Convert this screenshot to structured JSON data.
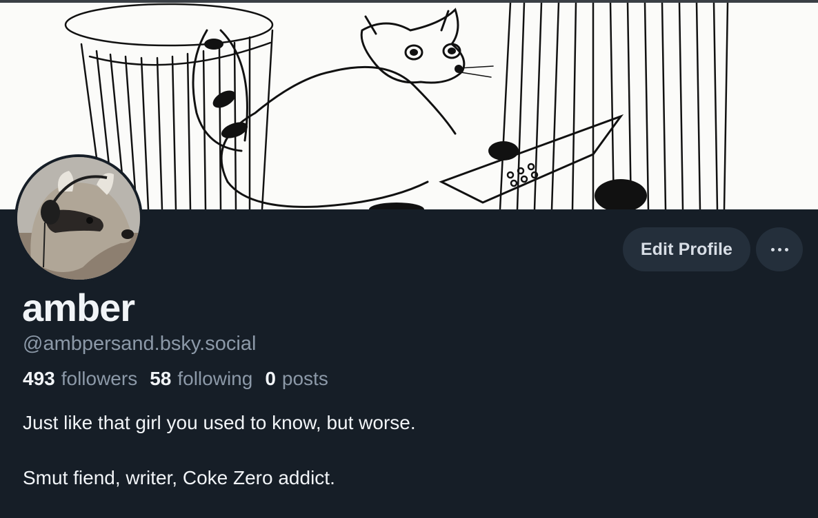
{
  "banner": {
    "icon": "raccoon-trashcan-sketch"
  },
  "avatar": {
    "icon": "raccoon-headphones-photo"
  },
  "actions": {
    "edit_profile_label": "Edit Profile",
    "more_icon": "ellipsis-icon"
  },
  "profile": {
    "display_name": "amber",
    "handle": "@ambpersand.bsky.social",
    "stats": {
      "followers_count": "493",
      "followers_label": "followers",
      "following_count": "58",
      "following_label": "following",
      "posts_count": "0",
      "posts_label": "posts"
    },
    "bio": [
      "Just like that girl you used to know, but worse.",
      "Smut fiend, writer, Coke Zero addict."
    ]
  },
  "colors": {
    "background": "#161e27",
    "button_bg": "#242f3b",
    "text_primary": "#f1f4f7",
    "text_secondary": "#8c99a8"
  }
}
